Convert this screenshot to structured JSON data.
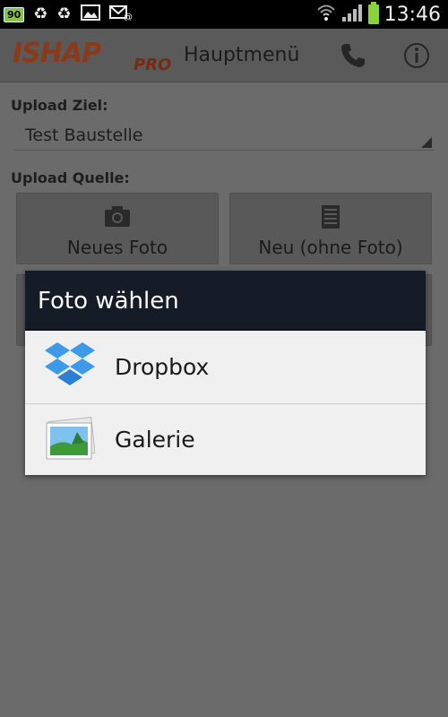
{
  "status_bar": {
    "badge": "90",
    "time": "13:46",
    "icons": [
      "recycle-icon",
      "recycle-icon",
      "image-icon",
      "mail-at-icon",
      "wifi-icon",
      "signal-icon",
      "battery-icon"
    ]
  },
  "app_bar": {
    "logo_text": "ISHAP",
    "logo_suffix": "PRO",
    "title": "Hauptmenü",
    "actions": [
      "phone-icon",
      "info-icon"
    ]
  },
  "form": {
    "upload_target_label": "Upload Ziel:",
    "upload_target_value": "Test Baustelle",
    "upload_source_label": "Upload Quelle:",
    "buttons": [
      {
        "label": "Neues Foto",
        "icon": "camera-icon"
      },
      {
        "label": "Neu (ohne Foto)",
        "icon": "document-icon"
      }
    ]
  },
  "dialog": {
    "title": "Foto wählen",
    "items": [
      {
        "label": "Dropbox",
        "icon": "dropbox-icon"
      },
      {
        "label": "Galerie",
        "icon": "gallery-icon"
      }
    ]
  },
  "colors": {
    "overlay_bg": "#6b6b6b",
    "dialog_header": "#161b28",
    "dialog_body": "#f0f0f0",
    "battery_green": "#8bd13a",
    "logo_orange": "#8a3a18"
  }
}
